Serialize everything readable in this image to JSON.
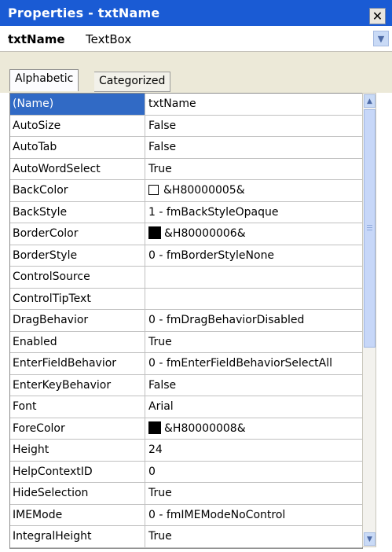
{
  "window": {
    "title": "Properties - txtName"
  },
  "object_selector": {
    "name": "txtName",
    "type": "TextBox"
  },
  "tabs": [
    {
      "label": "Alphabetic",
      "active": true
    },
    {
      "label": "Categorized",
      "active": false
    }
  ],
  "properties": [
    {
      "name": "(Name)",
      "value": "txtName",
      "selected": true
    },
    {
      "name": "AutoSize",
      "value": "False"
    },
    {
      "name": "AutoTab",
      "value": "False"
    },
    {
      "name": "AutoWordSelect",
      "value": "True"
    },
    {
      "name": "BackColor",
      "value": "&H80000005&",
      "swatch": "#ffffff"
    },
    {
      "name": "BackStyle",
      "value": "1 - fmBackStyleOpaque"
    },
    {
      "name": "BorderColor",
      "value": "&H80000006&",
      "swatch": "#000000"
    },
    {
      "name": "BorderStyle",
      "value": "0 - fmBorderStyleNone"
    },
    {
      "name": "ControlSource",
      "value": ""
    },
    {
      "name": "ControlTipText",
      "value": ""
    },
    {
      "name": "DragBehavior",
      "value": "0 - fmDragBehaviorDisabled"
    },
    {
      "name": "Enabled",
      "value": "True"
    },
    {
      "name": "EnterFieldBehavior",
      "value": "0 - fmEnterFieldBehaviorSelectAll"
    },
    {
      "name": "EnterKeyBehavior",
      "value": "False"
    },
    {
      "name": "Font",
      "value": "Arial"
    },
    {
      "name": "ForeColor",
      "value": "&H80000008&",
      "swatch": "#000000"
    },
    {
      "name": "Height",
      "value": "24"
    },
    {
      "name": "HelpContextID",
      "value": "0"
    },
    {
      "name": "HideSelection",
      "value": "True"
    },
    {
      "name": "IMEMode",
      "value": "0 - fmIMEModeNoControl"
    },
    {
      "name": "IntegralHeight",
      "value": "True"
    }
  ],
  "scrollbar": {
    "position": 0.0
  },
  "colors": {
    "titlebar": "#1a5bd4",
    "selection": "#316ac5",
    "scroll_accent": "#c9daf6"
  },
  "icons": {
    "close": "close-icon",
    "dropdown": "chevron-down-icon",
    "scroll_up": "arrow-up-icon",
    "scroll_down": "arrow-down-icon"
  }
}
